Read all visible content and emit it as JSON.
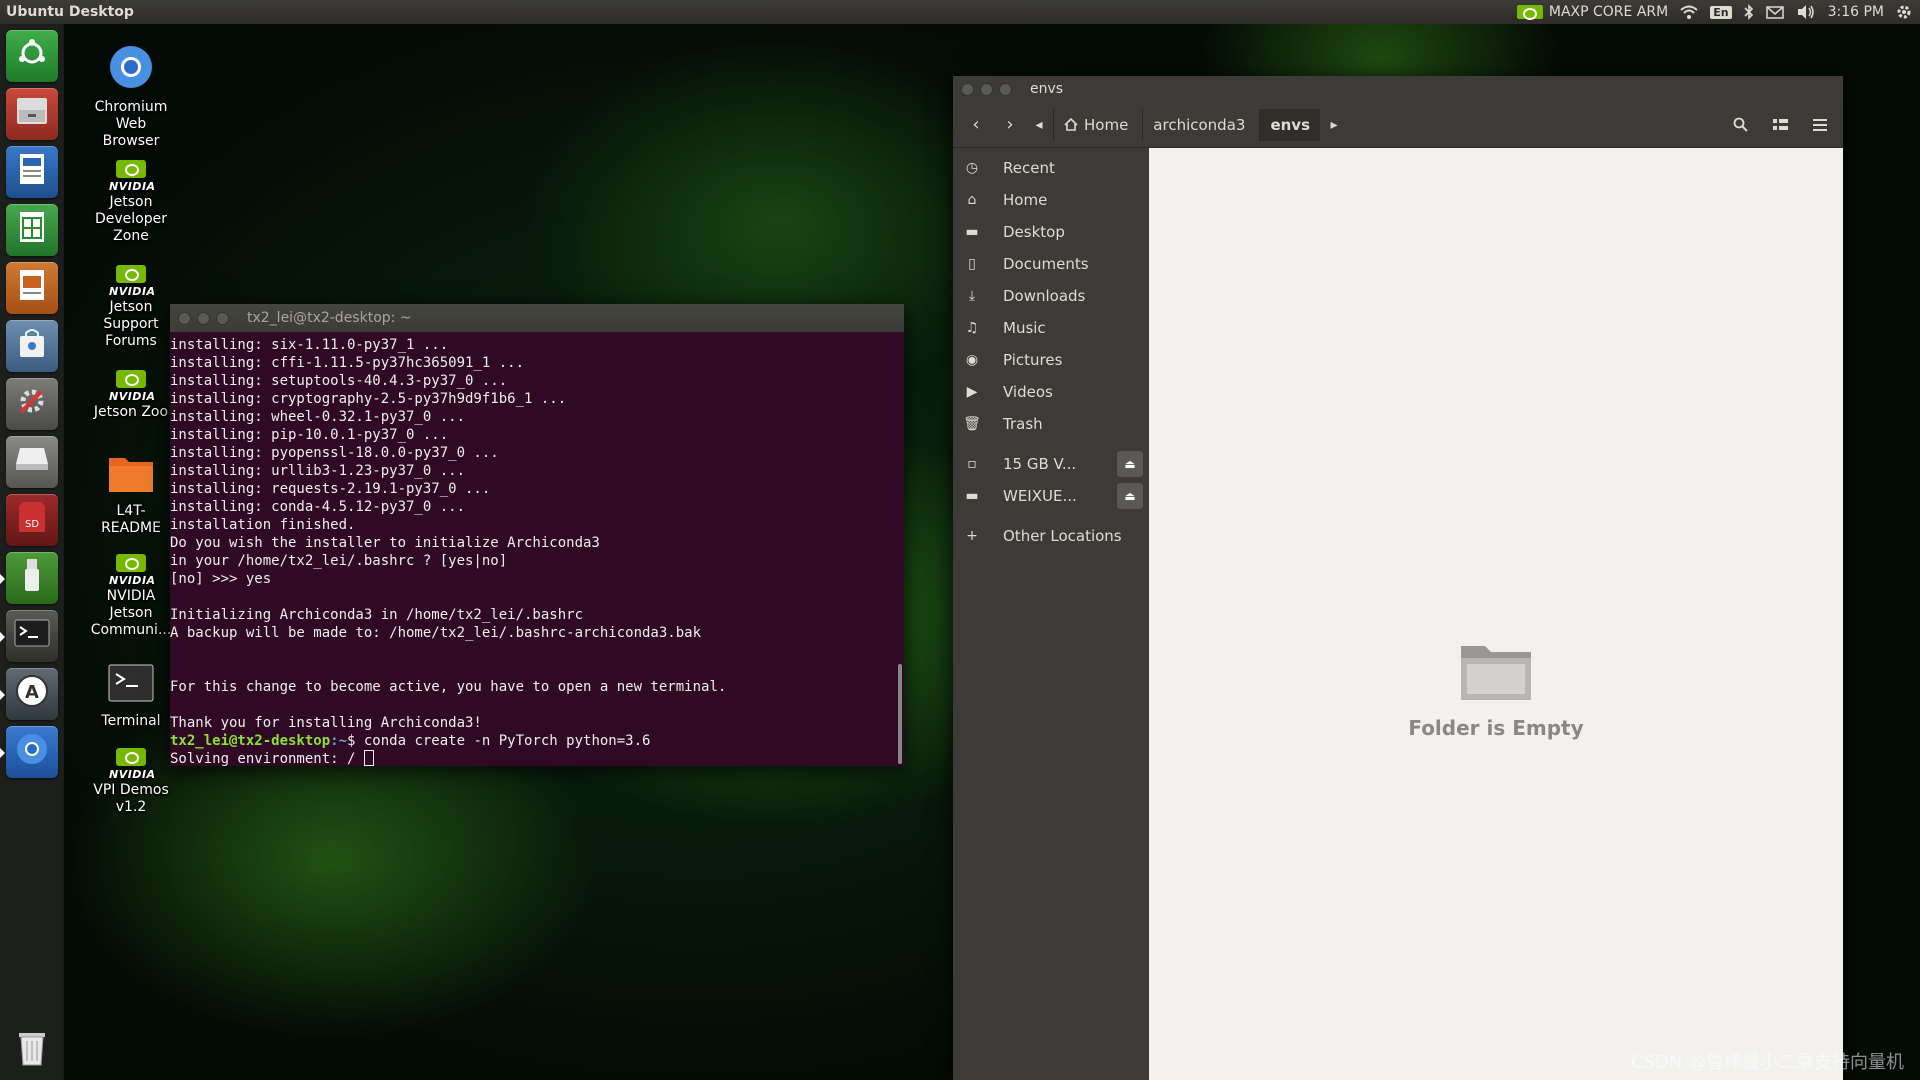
{
  "top_panel": {
    "title": "Ubuntu Desktop",
    "power_mode": "MAXP CORE ARM",
    "language": "En",
    "time": "3:16 PM"
  },
  "launcher": {
    "items": [
      {
        "name": "ubuntu-dash",
        "icon": "ubuntu-logo-icon"
      },
      {
        "name": "files",
        "icon": "file-cabinet-icon"
      },
      {
        "name": "libreoffice-writer",
        "icon": "writer-icon"
      },
      {
        "name": "libreoffice-calc",
        "icon": "calc-icon"
      },
      {
        "name": "libreoffice-impress",
        "icon": "impress-icon"
      },
      {
        "name": "software-center",
        "icon": "shopping-bag-icon"
      },
      {
        "name": "system-settings",
        "icon": "settings-tools-icon"
      },
      {
        "name": "drive",
        "icon": "hard-drive-icon"
      },
      {
        "name": "sd-card",
        "icon": "sd-card-icon"
      },
      {
        "name": "usb",
        "icon": "usb-icon"
      },
      {
        "name": "terminal",
        "icon": "terminal-icon"
      },
      {
        "name": "software-updater",
        "icon": "updater-icon"
      },
      {
        "name": "chromium",
        "icon": "chromium-icon"
      },
      {
        "name": "trash",
        "icon": "trash-icon"
      }
    ]
  },
  "desktop_icons": [
    {
      "label": "Chromium Web Browser",
      "icon": "chromium-icon"
    },
    {
      "label": "NVIDIA Jetson Developer Zone",
      "logo_text": "NVIDIA",
      "lines": [
        "Jetson",
        "Developer",
        "Zone"
      ]
    },
    {
      "label": "NVIDIA Jetson Support Forums",
      "logo_text": "NVIDIA",
      "lines": [
        "Jetson",
        "Support",
        "Forums"
      ]
    },
    {
      "label": "Jetson Zoo",
      "logo_text": "NVIDIA",
      "lines": [
        "Jetson Zoo"
      ]
    },
    {
      "label": "L4T-README",
      "icon": "folder-icon",
      "lines": [
        "L4T-",
        "README"
      ]
    },
    {
      "label": "NVIDIA Jetson Communi...",
      "logo_text": "NVIDIA",
      "lines": [
        "NVIDIA",
        "Jetson",
        "Communi..."
      ]
    },
    {
      "label": "Terminal",
      "icon": "terminal-icon",
      "lines": [
        "Terminal"
      ]
    },
    {
      "label": "VPI Demos v1.2",
      "logo_text": "NVIDIA",
      "lines": [
        "VPI Demos",
        "v1.2"
      ]
    }
  ],
  "terminal": {
    "title": "tx2_lei@tx2-desktop: ~",
    "lines": [
      "installing: six-1.11.0-py37_1 ...",
      "installing: cffi-1.11.5-py37hc365091_1 ...",
      "installing: setuptools-40.4.3-py37_0 ...",
      "installing: cryptography-2.5-py37h9d9f1b6_1 ...",
      "installing: wheel-0.32.1-py37_0 ...",
      "installing: pip-10.0.1-py37_0 ...",
      "installing: pyopenssl-18.0.0-py37_0 ...",
      "installing: urllib3-1.23-py37_0 ...",
      "installing: requests-2.19.1-py37_0 ...",
      "installing: conda-4.5.12-py37_0 ...",
      "installation finished.",
      "Do you wish the installer to initialize Archiconda3",
      "in your /home/tx2_lei/.bashrc ? [yes|no]",
      "[no] >>> yes",
      "",
      "Initializing Archiconda3 in /home/tx2_lei/.bashrc",
      "A backup will be made to: /home/tx2_lei/.bashrc-archiconda3.bak",
      "",
      "",
      "For this change to become active, you have to open a new terminal.",
      "",
      "Thank you for installing Archiconda3!"
    ],
    "prompt_user": "tx2_lei@tx2-desktop",
    "prompt_path": ":~",
    "prompt_symbol": "$ ",
    "command": "conda create -n PyTorch python=3.6",
    "last_line": "Solving environment: / "
  },
  "files": {
    "title": "envs",
    "breadcrumbs": [
      "Home",
      "archiconda3",
      "envs"
    ],
    "sidebar": [
      {
        "label": "Recent",
        "icon": "clock-icon"
      },
      {
        "label": "Home",
        "icon": "home-icon"
      },
      {
        "label": "Desktop",
        "icon": "desktop-folder-icon"
      },
      {
        "label": "Documents",
        "icon": "document-icon"
      },
      {
        "label": "Downloads",
        "icon": "download-icon"
      },
      {
        "label": "Music",
        "icon": "music-icon"
      },
      {
        "label": "Pictures",
        "icon": "camera-icon"
      },
      {
        "label": "Videos",
        "icon": "video-icon"
      },
      {
        "label": "Trash",
        "icon": "trash-icon"
      }
    ],
    "devices": [
      {
        "label": "15 GB V...",
        "icon": "drive-icon"
      },
      {
        "label": "WEIXUE...",
        "icon": "drive-icon"
      }
    ],
    "other_locations": "Other Locations",
    "empty_text": "Folder is Empty"
  },
  "watermark": "CSDN @鲁棒最小二乘支持向量机"
}
